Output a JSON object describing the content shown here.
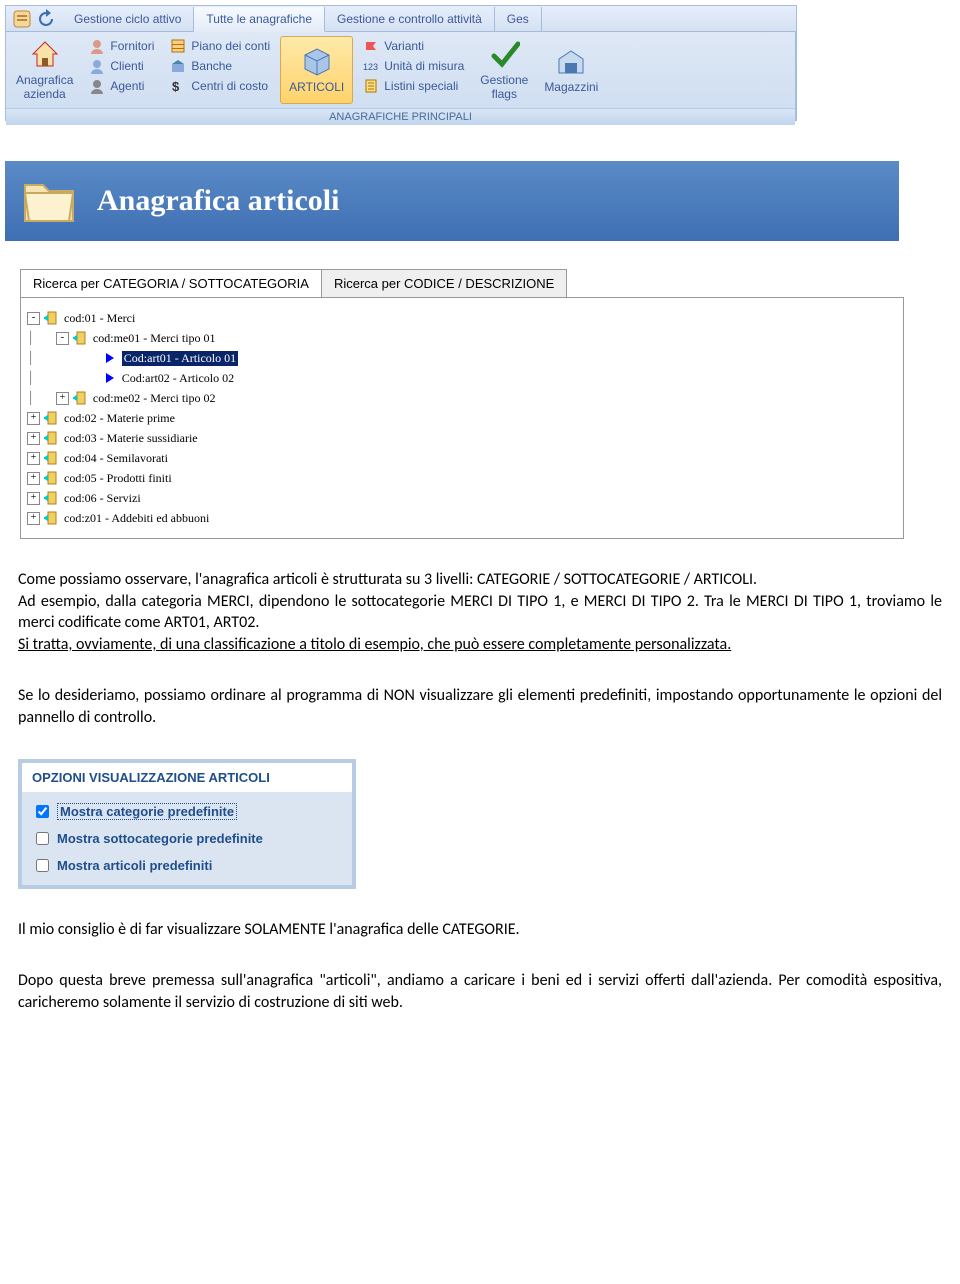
{
  "ribbon": {
    "tabs": [
      "Gestione ciclo attivo",
      "Tutte le anagrafiche",
      "Gestione e controllo attività",
      "Ges"
    ],
    "anagrafica_azienda": "Anagrafica\nazienda",
    "col1": [
      "Fornitori",
      "Clienti",
      "Agenti"
    ],
    "col2": [
      "Piano dei conti",
      "Banche",
      "Centri di costo"
    ],
    "articoli": "ARTICOLI",
    "col3": [
      "Varianti",
      "Unità di misura",
      "Listini speciali"
    ],
    "gestione_flags": "Gestione\nflags",
    "magazzini": "Magazzini",
    "group_caption": "ANAGRAFICHE PRINCIPALI"
  },
  "banner": {
    "title": "Anagrafica articoli"
  },
  "search_tabs": [
    "Ricerca per CATEGORIA / SOTTOCATEGORIA",
    "Ricerca per CODICE / DESCRIZIONE"
  ],
  "tree": [
    {
      "indent": 0,
      "pm": "-",
      "icon": "cat",
      "label": "cod:01 - Merci"
    },
    {
      "indent": 1,
      "pm": "-",
      "icon": "cat",
      "label": "cod:me01 - Merci tipo 01"
    },
    {
      "indent": 2,
      "pm": "",
      "icon": "art",
      "label": "Cod:art01 - Articolo 01",
      "sel": true
    },
    {
      "indent": 2,
      "pm": "",
      "icon": "art",
      "label": "Cod:art02 - Articolo 02"
    },
    {
      "indent": 1,
      "pm": "+",
      "icon": "cat",
      "label": "cod:me02 - Merci tipo 02"
    },
    {
      "indent": 0,
      "pm": "+",
      "icon": "cat",
      "label": "cod:02 - Materie prime"
    },
    {
      "indent": 0,
      "pm": "+",
      "icon": "cat",
      "label": "cod:03 - Materie sussidiarie"
    },
    {
      "indent": 0,
      "pm": "+",
      "icon": "cat",
      "label": "cod:04 - Semilavorati"
    },
    {
      "indent": 0,
      "pm": "+",
      "icon": "cat",
      "label": "cod:05 - Prodotti finiti"
    },
    {
      "indent": 0,
      "pm": "+",
      "icon": "cat",
      "label": "cod:06 - Servizi"
    },
    {
      "indent": 0,
      "pm": "+",
      "icon": "cat",
      "label": "cod:z01 - Addebiti ed abbuoni"
    }
  ],
  "prose": {
    "p1a": "Come possiamo osservare, l'anagrafica articoli è strutturata su 3 livelli: CATEGORIE / SOTTOCATEGORIE / ARTICOLI.",
    "p1b": "Ad esempio, dalla categoria MERCI, dipendono le sottocategorie MERCI DI TIPO 1, e MERCI DI TIPO 2. Tra le MERCI DI TIPO 1, troviamo le merci codificate come ART01, ART02.",
    "p1c": "Si tratta, ovviamente, di una classificazione a titolo di esempio, che può essere completamente personalizzata.",
    "p2": "Se lo desideriamo, possiamo ordinare al programma di NON visualizzare gli elementi predefiniti, impostando opportunamente le opzioni del pannello di controllo.",
    "p3": "Il mio consiglio è di far visualizzare SOLAMENTE l'anagrafica delle CATEGORIE.",
    "p4": "Dopo questa breve premessa sull'anagrafica \"articoli\", andiamo a caricare i beni ed i servizi offerti dall'azienda. Per comodità espositiva, caricheremo solamente il servizio di costruzione di siti web."
  },
  "opts": {
    "header": "OPZIONI VISUALIZZAZIONE ARTICOLI",
    "items": [
      {
        "label": "Mostra categorie predefinite",
        "checked": true,
        "focus": true
      },
      {
        "label": "Mostra sottocategorie predefinite",
        "checked": false
      },
      {
        "label": "Mostra articoli predefiniti",
        "checked": false
      }
    ]
  }
}
